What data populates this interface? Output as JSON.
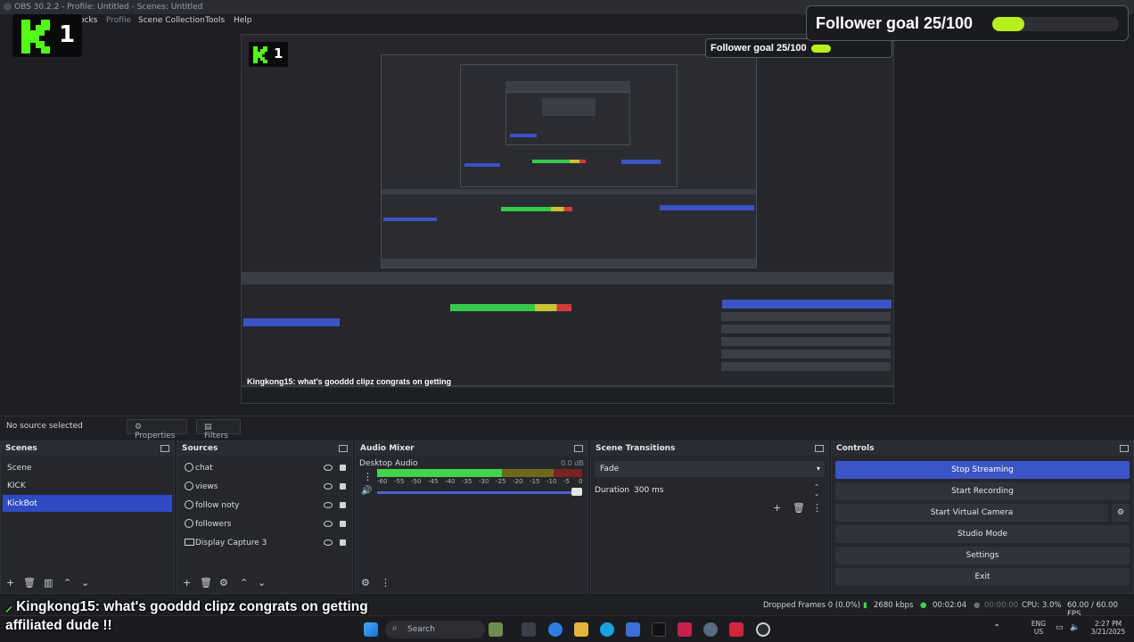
{
  "window": {
    "title": "OBS 30.2.2 - Profile: Untitled - Scenes: Untitled"
  },
  "menu": {
    "docks": "ocks",
    "profile": "Profile",
    "scene_collection": "Scene Collection",
    "tools": "Tools",
    "help": "Help"
  },
  "overlay": {
    "kick_number": "1",
    "follower_goal": "Follower goal 25/100",
    "follower_progress": 0.25,
    "chat_line1_user": "Kingkong15:",
    "chat_line1_msg": "what's gooddd clipz congrats on getting",
    "chat_line2": "affiliated dude !!"
  },
  "source_bar": {
    "no_source": "No source selected",
    "properties": "Properties",
    "filters": "Filters"
  },
  "scenes": {
    "title": "Scenes",
    "items": [
      "Scene",
      "KICK",
      "KickBot"
    ],
    "selected": "KickBot"
  },
  "sources": {
    "title": "Sources",
    "items": [
      "chat",
      "views",
      "follow noty",
      "followers",
      "Display Capture 3"
    ]
  },
  "audio_mixer": {
    "title": "Audio Mixer",
    "channel": "Desktop Audio",
    "db": "0.0 dB",
    "scale": [
      "-60",
      "-55",
      "-50",
      "-45",
      "-40",
      "-35",
      "-30",
      "-25",
      "-20",
      "-15",
      "-10",
      "-5",
      "0"
    ]
  },
  "scene_transitions": {
    "title": "Scene Transitions",
    "transition": "Fade",
    "duration_label": "Duration",
    "duration_value": "300 ms"
  },
  "controls": {
    "title": "Controls",
    "stop_streaming": "Stop Streaming",
    "start_recording": "Start Recording",
    "start_virtual_camera": "Start Virtual Camera",
    "studio_mode": "Studio Mode",
    "settings": "Settings",
    "exit": "Exit"
  },
  "status": {
    "dropped_frames": "Dropped Frames 0 (0.0%)",
    "bitrate": "2680 kbps",
    "stream_time": "00:02:04",
    "rec_time": "00:00:00",
    "cpu": "CPU: 3.0%",
    "fps": "60.00 / 60.00 FPS"
  },
  "taskbar": {
    "search_placeholder": "Search",
    "lang_top": "ENG",
    "lang_bottom": "US",
    "time": "2:27 PM",
    "date": "3/21/2025"
  },
  "colors": {
    "accent": "#3a55c6",
    "goal_fill": "#b8f01e",
    "kick_green": "#53fc18"
  }
}
